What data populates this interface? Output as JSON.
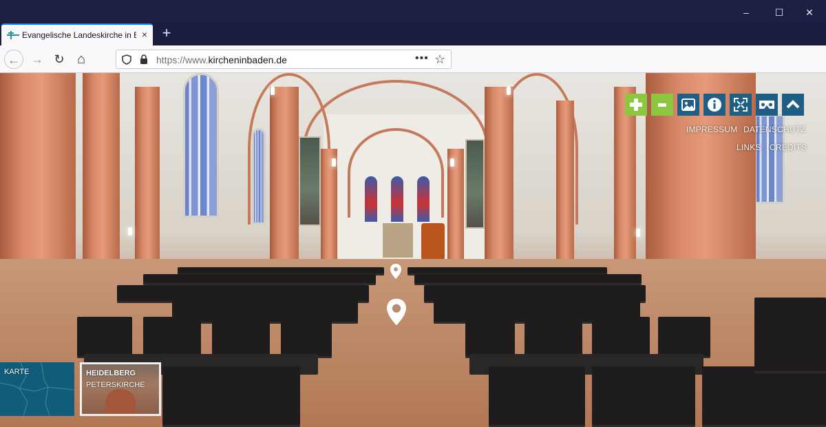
{
  "browser": {
    "tab_title": "Evangelische Landeskirche in B",
    "close_tab": "×",
    "new_tab": "+",
    "window_controls": {
      "minimize": "–",
      "maximize": "☐",
      "close": "✕"
    },
    "nav": {
      "back": "←",
      "forward": "→",
      "reload": "↻",
      "home": "⌂"
    },
    "url_prefix": "https://www.",
    "url_domain": "kircheninbaden.de",
    "url_more": "•••",
    "bookmark": "☆"
  },
  "tour": {
    "controls": [
      {
        "name": "zoom-in-button",
        "icon": "plus-icon"
      },
      {
        "name": "zoom-out-button",
        "icon": "minus-icon"
      },
      {
        "name": "gallery-button",
        "icon": "image-icon"
      },
      {
        "name": "info-button",
        "icon": "info-icon"
      },
      {
        "name": "fullscreen-button",
        "icon": "fullscreen-icon"
      },
      {
        "name": "vr-button",
        "icon": "vr-headset-icon"
      },
      {
        "name": "collapse-button",
        "icon": "chevron-up-icon"
      }
    ],
    "links": {
      "impressum": "IMPRESSUM",
      "datenschutz": "DATENSCHUTZ",
      "links": "LINKS",
      "credits": "CREDITS"
    },
    "thumbnails": {
      "karte": "KARTE",
      "church_city": "HEIDELBERG",
      "church_name": "PETERSKIRCHE"
    },
    "colors": {
      "green": "#8dc63f",
      "blue": "#1f5f86"
    }
  }
}
